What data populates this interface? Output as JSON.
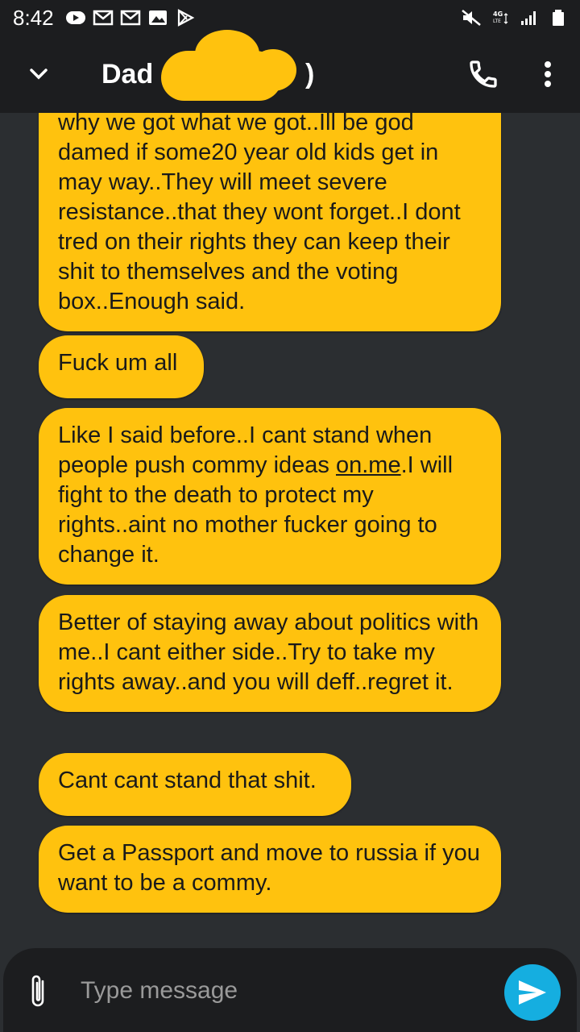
{
  "status_bar": {
    "time": "8:42",
    "notification_icons": [
      "video-icon",
      "gmail-icon",
      "gmail-icon",
      "image-icon",
      "play-store-icon"
    ],
    "right_icons": [
      "mute-icon",
      "4g-lte-icon",
      "signal-icon",
      "battery-icon"
    ]
  },
  "header": {
    "contact_name": "Dad (",
    "contact_name_suffix": ")"
  },
  "messages": [
    {
      "text": "why we got what we got..Ill be god damed if some20 year old kids get in may way..They will meet severe resistance..that they wont forget..I dont tred on their rights they can keep their shit to themselves and the voting box..Enough said."
    },
    {
      "text": "Fuck um all"
    },
    {
      "text_before": "Like I said before..I cant stand when people push commy ideas ",
      "link": "on.me",
      "text_after": ".I will fight to the death to protect my rights..aint no mother fucker going to change it."
    },
    {
      "text": "Better of staying away about politics with me..I cant either side..Try to take my rights away..and you will deff..regret it."
    },
    {
      "text": "Cant cant stand that shit."
    },
    {
      "text": "Get a Passport and move to russia if you want to be a commy."
    }
  ],
  "composer": {
    "placeholder": "Type message"
  },
  "colors": {
    "bubble": "#ffc20e",
    "send_button": "#15aee0",
    "background": "#2b2e31",
    "bar": "#1c1d1f"
  }
}
